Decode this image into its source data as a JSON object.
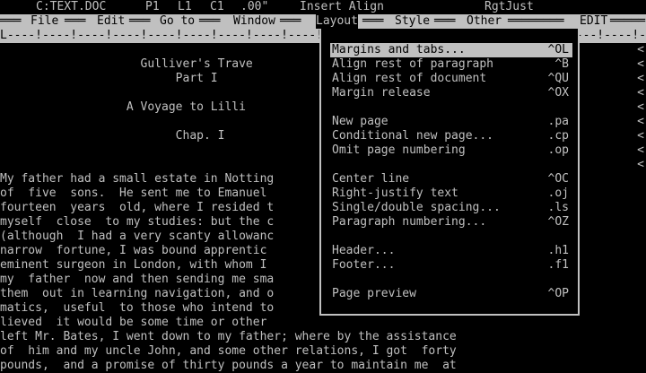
{
  "status": {
    "file": "C:TEXT.DOC",
    "page": "P1",
    "line": "L1",
    "col": "C1",
    "pos": ".00\"",
    "mode": "Insert Align",
    "justify": "RgtJust"
  },
  "menubar": {
    "file": "File",
    "edit": "Edit",
    "goto": "Go to",
    "window": "Window",
    "layout": "Layout",
    "style": "Style",
    "other": "Other",
    "edit_mode": "EDIT"
  },
  "ruler": "L----!----!----!----!----!----!----!----!----!----!----!----!----!----!----!----!----!----!---",
  "doc_lines": [
    "",
    "                    Gulliver's Trave",
    "                         Part I",
    "",
    "                  A Voyage to Lilli",
    "",
    "                         Chap. I",
    "",
    "",
    "My father had a small estate in Notting",
    "of  five  sons.  He sent me to Emanuel",
    "fourteen  years  old, where I resided t",
    "myself  close  to my studies: but the c",
    "(although  I had a very scanty allowanc",
    "narrow  fortune, I was bound apprentic",
    "eminent surgeon in London, with whom I",
    "my  father  now and then sending me sma",
    "them  out in learning navigation, and o",
    "matics,  useful  to those who intend to",
    "lieved  it would be some time or other",
    "left Mr. Bates, I went down to my father; where by the assistance",
    "of  him and my uncle John, and some other relations, I got  forty",
    "pounds,  and a promise of thirty pounds a year to maintain me  at"
  ],
  "right_marker": "<",
  "layout_menu": [
    {
      "label": "Margins and tabs...",
      "key": "^OL"
    },
    {
      "label": "Align rest of paragraph",
      "key": "^B"
    },
    {
      "label": "Align rest of document",
      "key": "^QU"
    },
    {
      "label": "Margin release",
      "key": "^OX"
    },
    {
      "label": "",
      "key": ""
    },
    {
      "label": "New page",
      "key": ".pa"
    },
    {
      "label": "Conditional new page...",
      "key": ".cp"
    },
    {
      "label": "Omit page numbering",
      "key": ".op"
    },
    {
      "label": "",
      "key": ""
    },
    {
      "label": "Center line",
      "key": "^OC"
    },
    {
      "label": "Right-justify text",
      "key": ".oj"
    },
    {
      "label": "Single/double spacing...",
      "key": ".ls"
    },
    {
      "label": "Paragraph numbering...",
      "key": "^OZ"
    },
    {
      "label": "",
      "key": ""
    },
    {
      "label": "Header...",
      "key": ".h1"
    },
    {
      "label": "Footer...",
      "key": ".f1"
    },
    {
      "label": "",
      "key": ""
    },
    {
      "label": "Page preview",
      "key": "^OP"
    }
  ]
}
